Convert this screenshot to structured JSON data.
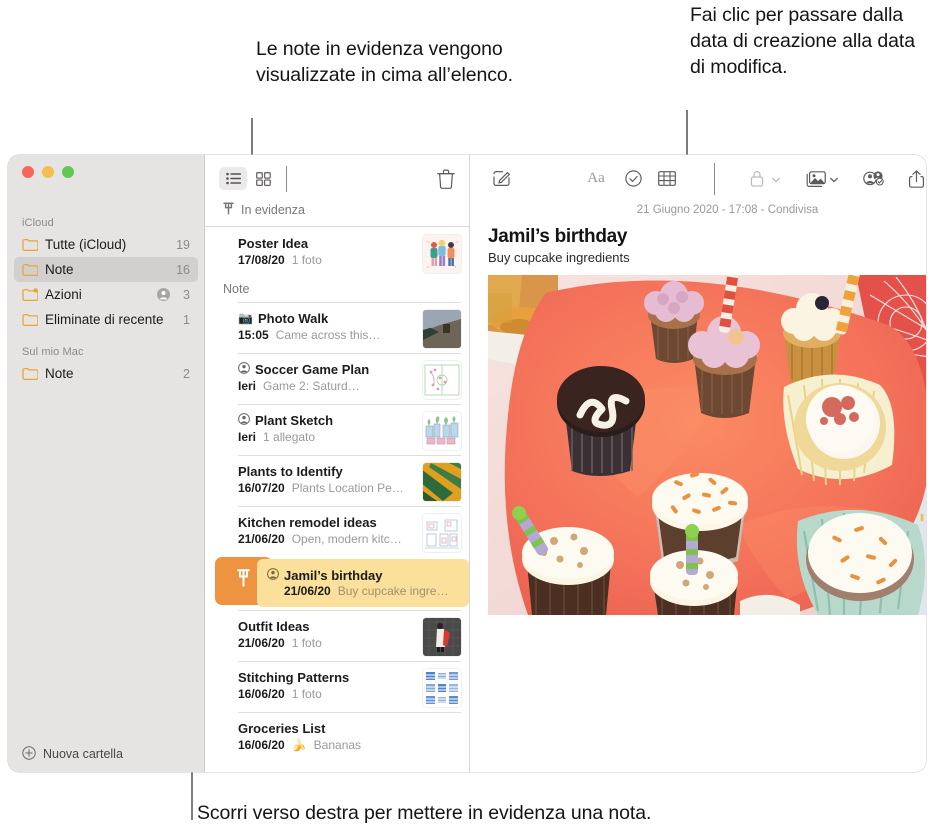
{
  "callouts": {
    "pinned": "Le note in evidenza vengono visualizzate in cima all’elenco.",
    "date": "Fai clic per passare dalla data di creazione alla data di modifica.",
    "swipe": "Scorri verso destra per mettere in evidenza una nota."
  },
  "window": {
    "traffic_lights": [
      {
        "name": "close",
        "color": "#f9655b"
      },
      {
        "name": "minimize",
        "color": "#f6bc4f"
      },
      {
        "name": "zoom",
        "color": "#61c654"
      }
    ]
  },
  "sidebar": {
    "sections": [
      {
        "title": "iCloud",
        "items": [
          {
            "label": "Tutte (iCloud)",
            "count": "19",
            "selected": false,
            "shared": false
          },
          {
            "label": "Note",
            "count": "16",
            "selected": true,
            "shared": false
          },
          {
            "label": "Azioni",
            "count": "3",
            "selected": false,
            "shared": true
          },
          {
            "label": "Eliminate di recente",
            "count": "1",
            "selected": false,
            "shared": false
          }
        ]
      },
      {
        "title": "Sul mio Mac",
        "items": [
          {
            "label": "Note",
            "count": "2",
            "selected": false,
            "shared": false
          }
        ]
      }
    ],
    "new_folder_label": "Nuova cartella"
  },
  "list_toolbar": {
    "view_list_icon": "list-view-icon",
    "view_grid_icon": "gallery-view-icon",
    "delete_icon": "trash-icon"
  },
  "notes_list": {
    "pinned_header": "In evidenza",
    "group_label": "Note",
    "pinned_notes": [
      {
        "title": "Poster Idea",
        "date": "17/08/20",
        "snippet": "1 foto",
        "has_thumb": true,
        "thumb": "poster-people-sketch",
        "shared": false,
        "emoji": ""
      }
    ],
    "notes": [
      {
        "title": "Photo Walk",
        "date": "15:05",
        "snippet": "Came across this…",
        "has_thumb": true,
        "thumb": "photo-wall-dark",
        "shared": false,
        "emoji": "📷"
      },
      {
        "title": "Soccer Game Plan",
        "date": "Ieri",
        "snippet": "Game 2: Saturd…",
        "has_thumb": true,
        "thumb": "soccer-field-diagram",
        "shared": true,
        "emoji": ""
      },
      {
        "title": "Plant Sketch",
        "date": "Ieri",
        "snippet": "1 allegato",
        "has_thumb": true,
        "thumb": "plants-sketch",
        "shared": true,
        "emoji": ""
      },
      {
        "title": "Plants to Identify",
        "date": "16/07/20",
        "snippet": "Plants Location Pe…",
        "has_thumb": true,
        "thumb": "palm-leaf-yellow",
        "shared": false,
        "emoji": ""
      },
      {
        "title": "Kitchen remodel ideas",
        "date": "21/06/20",
        "snippet": "Open, modern kitc…",
        "has_thumb": true,
        "thumb": "floorplan-sketch",
        "shared": false,
        "emoji": ""
      }
    ],
    "swiped_note": {
      "title": "Jamil’s birthday",
      "date": "21/06/20",
      "snippet": "Buy cupcake ingre…",
      "shared": true,
      "pin_action_icon": "pin-icon",
      "pin_color": "#ee9440",
      "row_color": "#fae09a"
    },
    "notes_after": [
      {
        "title": "Outfit Ideas",
        "date": "21/06/20",
        "snippet": "1 foto",
        "has_thumb": true,
        "thumb": "outfit-red-coat",
        "shared": false,
        "emoji": ""
      },
      {
        "title": "Stitching Patterns",
        "date": "16/06/20",
        "snippet": "1 foto",
        "has_thumb": true,
        "thumb": "stitching-grid-blue",
        "shared": false,
        "emoji": ""
      },
      {
        "title": "Groceries List",
        "date": "16/06/20",
        "snippet": "Bananas",
        "has_thumb": false,
        "thumb": "",
        "shared": false,
        "emoji": "🍌"
      }
    ]
  },
  "editor_toolbar": {
    "compose_icon": "compose-note-icon",
    "format_icon": "text-format-icon",
    "checklist_icon": "checklist-icon",
    "table_icon": "table-icon",
    "lock_icon": "lock-icon",
    "media_icon": "media-icon",
    "collaborate_icon": "collaborate-icon",
    "share_icon": "share-icon",
    "search_icon": "search-icon"
  },
  "note": {
    "meta_line": "21 Giugno 2020 - 17:08 - Condivisa",
    "title": "Jamil’s birthday",
    "line2": "Buy cupcake ingredients",
    "photo_alt": "cupcakes-on-orange-tray"
  }
}
